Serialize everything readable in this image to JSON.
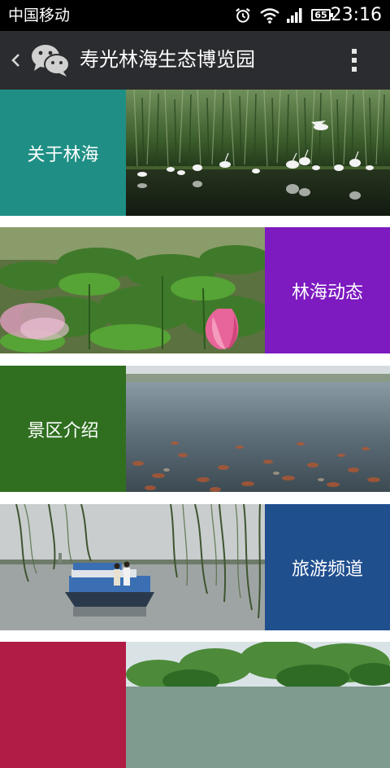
{
  "status_bar": {
    "carrier": "中国移动",
    "battery": "65",
    "time": "23:16",
    "icons": [
      "alarm-icon",
      "wifi-icon",
      "signal-icon",
      "battery-icon"
    ]
  },
  "header": {
    "title": "寿光林海生态博览园",
    "background": "#2b2c2f",
    "icons": [
      "back-icon",
      "wechat-logo-icon",
      "more-options-icon"
    ]
  },
  "menu": {
    "items": [
      {
        "label": "关于林海",
        "color": "#1f8f85",
        "tile_side": "left"
      },
      {
        "label": "林海动态",
        "color": "#7d1ac0",
        "tile_side": "right"
      },
      {
        "label": "景区介绍",
        "color": "#2f6f1f",
        "tile_side": "left"
      },
      {
        "label": "旅游频道",
        "color": "#204f8e",
        "tile_side": "right"
      },
      {
        "label": "",
        "color": "#b11c44",
        "tile_side": "left"
      }
    ]
  }
}
